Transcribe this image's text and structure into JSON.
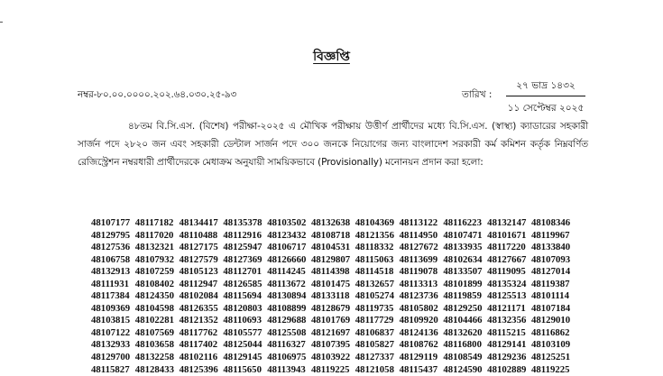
{
  "notice": {
    "title": "বিজ্ঞপ্তি",
    "memo_no": "নম্বর-৮০.০০.০০০০.২০২.৬৪.০৩০.২৫-৯৩",
    "date_label": "তারিখ :",
    "date_bangla": "২৭ ভাদ্র ১৪৩২",
    "date_english": "১১ সেপ্টেম্বর ২০২৫",
    "body": "৪৮তম বি.সি.এস. (বিশেষ) পরীক্ষা-২০২৫ এ মৌখিক পরীক্ষায় উত্তীর্ণ প্রার্থীদের মধ্যে বি.সি.এস. (স্বাস্থ্য) ক্যাডারের সহকারী সার্জন পদে ২৮২০ জন এবং সহকারী ডেন্টাল সার্জন পদে ৩০০ জনকে নিয়োগের জন্য বাংলাদেশ সরকারী কর্ম কমিশন কর্তৃক নিম্নবর্ণিত রেজিস্ট্রেশন নম্বরধারী প্রার্থীদেরকে মেধাক্রম অনুযায়ী সাময়িকভাবে (Provisionally) মনোনয়ন প্রদান করা হলো:"
  },
  "registration_numbers": [
    [
      "48107177",
      "48117182",
      "48134417",
      "48135378",
      "48103502",
      "48132638",
      "48104369",
      "48113122",
      "48116223",
      "48132147",
      "48108346"
    ],
    [
      "48129795",
      "48117020",
      "48110488",
      "48112916",
      "48123432",
      "48108718",
      "48121356",
      "48114950",
      "48107471",
      "48101671",
      "48119967"
    ],
    [
      "48127536",
      "48132321",
      "48127175",
      "48125947",
      "48106717",
      "48104531",
      "48118332",
      "48127672",
      "48133935",
      "48117220",
      "48133840"
    ],
    [
      "48106758",
      "48107932",
      "48127579",
      "48127369",
      "48126660",
      "48129807",
      "48115063",
      "48113699",
      "48102634",
      "48127667",
      "48107093"
    ],
    [
      "48132913",
      "48107259",
      "48105123",
      "48112701",
      "48114245",
      "48114398",
      "48114518",
      "48119078",
      "48133507",
      "48119095",
      "48127014"
    ],
    [
      "48111931",
      "48108402",
      "48112947",
      "48126585",
      "48113672",
      "48101475",
      "48132657",
      "48113313",
      "48101899",
      "48135324",
      "48119387"
    ],
    [
      "48117384",
      "48124350",
      "48102084",
      "48115694",
      "48130894",
      "48133118",
      "48105274",
      "48123736",
      "48119859",
      "48125513",
      "48101114"
    ],
    [
      "48109369",
      "48104598",
      "48126355",
      "48120803",
      "48108899",
      "48128679",
      "48119735",
      "48105802",
      "48129250",
      "48121171",
      "48107184"
    ],
    [
      "48103815",
      "48102281",
      "48121352",
      "48110693",
      "48129688",
      "48101769",
      "48117729",
      "48109920",
      "48104466",
      "48132356",
      "48129010"
    ],
    [
      "48107122",
      "48107569",
      "48117762",
      "48105577",
      "48125508",
      "48121697",
      "48106837",
      "48124136",
      "48132620",
      "48115215",
      "48116862"
    ],
    [
      "48132933",
      "48103658",
      "48117402",
      "48125044",
      "48116327",
      "48107395",
      "48105827",
      "48108762",
      "48116800",
      "48129141",
      "48103109"
    ],
    [
      "48129700",
      "48132258",
      "48102116",
      "48129145",
      "48106975",
      "48103922",
      "48127337",
      "48129119",
      "48108549",
      "48129236",
      "48125251"
    ],
    [
      "48115827",
      "48128433",
      "48125396",
      "48115650",
      "48113943",
      "48119225",
      "48121058",
      "48115437",
      "48124590",
      "48102889",
      "48119225"
    ]
  ]
}
